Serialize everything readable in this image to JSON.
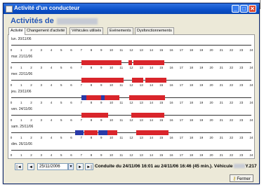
{
  "window": {
    "title": "Activité d'un conducteur",
    "heading": "Activités de",
    "controls": [
      "_",
      "□",
      "✕"
    ]
  },
  "tabs": [
    {
      "label": "Activité",
      "active": true
    },
    {
      "label": "Changement d'activité",
      "active": false
    },
    {
      "label": "Véhicules utilisés",
      "active": false
    },
    {
      "label": "Evénements",
      "active": false
    },
    {
      "label": "Dysfonctionnements",
      "active": false
    }
  ],
  "hours": [
    "0",
    "1",
    "2",
    "3",
    "4",
    "5",
    "6",
    "7",
    "8",
    "9",
    "10",
    "11",
    "12",
    "13",
    "14",
    "15",
    "16",
    "17",
    "18",
    "19",
    "20",
    "21",
    "22",
    "23",
    "24"
  ],
  "days": [
    {
      "label": "lun. 20/11/06",
      "segments": []
    },
    {
      "label": "mar. 21/11/06",
      "segments": [
        [
          7,
          11,
          "#d9252b"
        ],
        [
          11.7,
          12.1,
          "#d9252b"
        ],
        [
          12.2,
          15.3,
          "#d9252b"
        ]
      ]
    },
    {
      "label": "mer. 22/11/06",
      "segments": [
        [
          7,
          11.2,
          "#d9252b"
        ],
        [
          12.1,
          13.2,
          "#d9252b"
        ],
        [
          13.4,
          15.5,
          "#d9252b"
        ]
      ]
    },
    {
      "label": "jeu. 23/11/06",
      "segments": [
        [
          7,
          7.5,
          "#2a3aa8"
        ],
        [
          7.5,
          10.8,
          "#d9252b"
        ],
        [
          9,
          9.3,
          "#2a3aa8"
        ],
        [
          11.8,
          15.4,
          "#d9252b"
        ]
      ]
    },
    {
      "label": "ven. 24/11/06",
      "segments": [
        [
          7,
          8.4,
          "#d9252b"
        ],
        [
          8.4,
          9.7,
          "#d9252b"
        ],
        [
          12,
          15.3,
          "#d9252b"
        ]
      ]
    },
    {
      "label": "sam. 25/11/06",
      "segments": [
        [
          6.4,
          7.2,
          "#2a3aa8"
        ],
        [
          7.3,
          8.6,
          "#d9252b"
        ],
        [
          8.7,
          9.6,
          "#2a3aa8"
        ],
        [
          9.6,
          10.6,
          "#d9252b"
        ],
        [
          12.5,
          15.7,
          "#d9252b"
        ]
      ]
    },
    {
      "label": "dim. 26/11/06",
      "segments": []
    }
  ],
  "navigation": {
    "first_label": "|◄",
    "prev_label": "◄",
    "date_value": "25/11/2006",
    "dropdown_label": "▼",
    "next_label": "►",
    "last_label": "►|"
  },
  "summary": {
    "text": "Conduite du 24/11/06 16:01 au 24/11/06 16:46 (45 min.). Véhicule",
    "plate_suffix": "Y.217"
  },
  "close_button": {
    "label": "Fermer",
    "icon": "key-icon"
  },
  "colors": {
    "driving": "#d9252b",
    "work": "#2a3aa8",
    "title_bar": "#0a4fc9",
    "heading": "#2456b8"
  }
}
